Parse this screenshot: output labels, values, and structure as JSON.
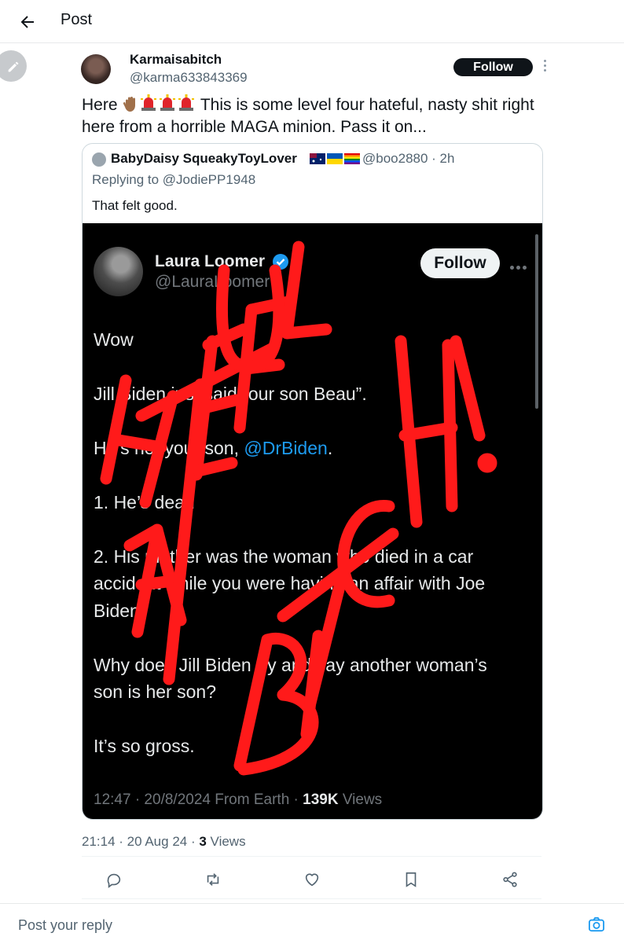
{
  "header": {
    "title": "Post"
  },
  "author": {
    "display_name": "Karmaisabitch",
    "handle": "@karma633843369",
    "follow_label": "Follow"
  },
  "post": {
    "text_before_emoji": "Here ",
    "emojis": [
      "raised-hand",
      "police-light",
      "police-light",
      "police-light"
    ],
    "text_after_emoji": " This is some level four hateful, nasty shit right here from a horrible MAGA minion. Pass it on..."
  },
  "quoted": {
    "display_name": "BabyDaisy SqueakyToyLover",
    "flags": [
      "australia-flag",
      "ukraine-flag",
      "rainbow-flag"
    ],
    "handle": "@boo2880 · 2h",
    "replying_to": "Replying to @JodiePP1948",
    "text": "That felt good."
  },
  "screenshot": {
    "display_name": "Laura Loomer",
    "handle": "@LauraLoomer",
    "follow_label": "Follow",
    "lines": [
      "Wow",
      "Jill Biden just said “our son Beau”.",
      "He’s not your son, ",
      "1. He’s dead",
      "2. His mother was the woman who died in a car",
      "accident while you were having an affair with Joe",
      "Biden.",
      "Why does Jill Biden try and say another woman’s",
      "son is her son?",
      "It’s so gross."
    ],
    "mention": "@DrBiden",
    "mention_suffix": ".",
    "footer_time": "12:47 · 20/8/2024 From Earth · ",
    "footer_views_count": "139K",
    "footer_views_label": " Views",
    "scribble_text": "HATEFUL BITCH!"
  },
  "stats": {
    "timestamp": "21:14 · 20 Aug 24 · ",
    "views_count": "3",
    "views_label": " Views"
  },
  "actions": [
    "reply-icon",
    "repost-icon",
    "like-icon",
    "bookmark-icon",
    "share-icon"
  ],
  "reply": {
    "placeholder": "Post your reply"
  },
  "colors": {
    "accent": "#1d9bf0",
    "scribble": "#ff1a1a",
    "text_secondary": "#536471"
  }
}
